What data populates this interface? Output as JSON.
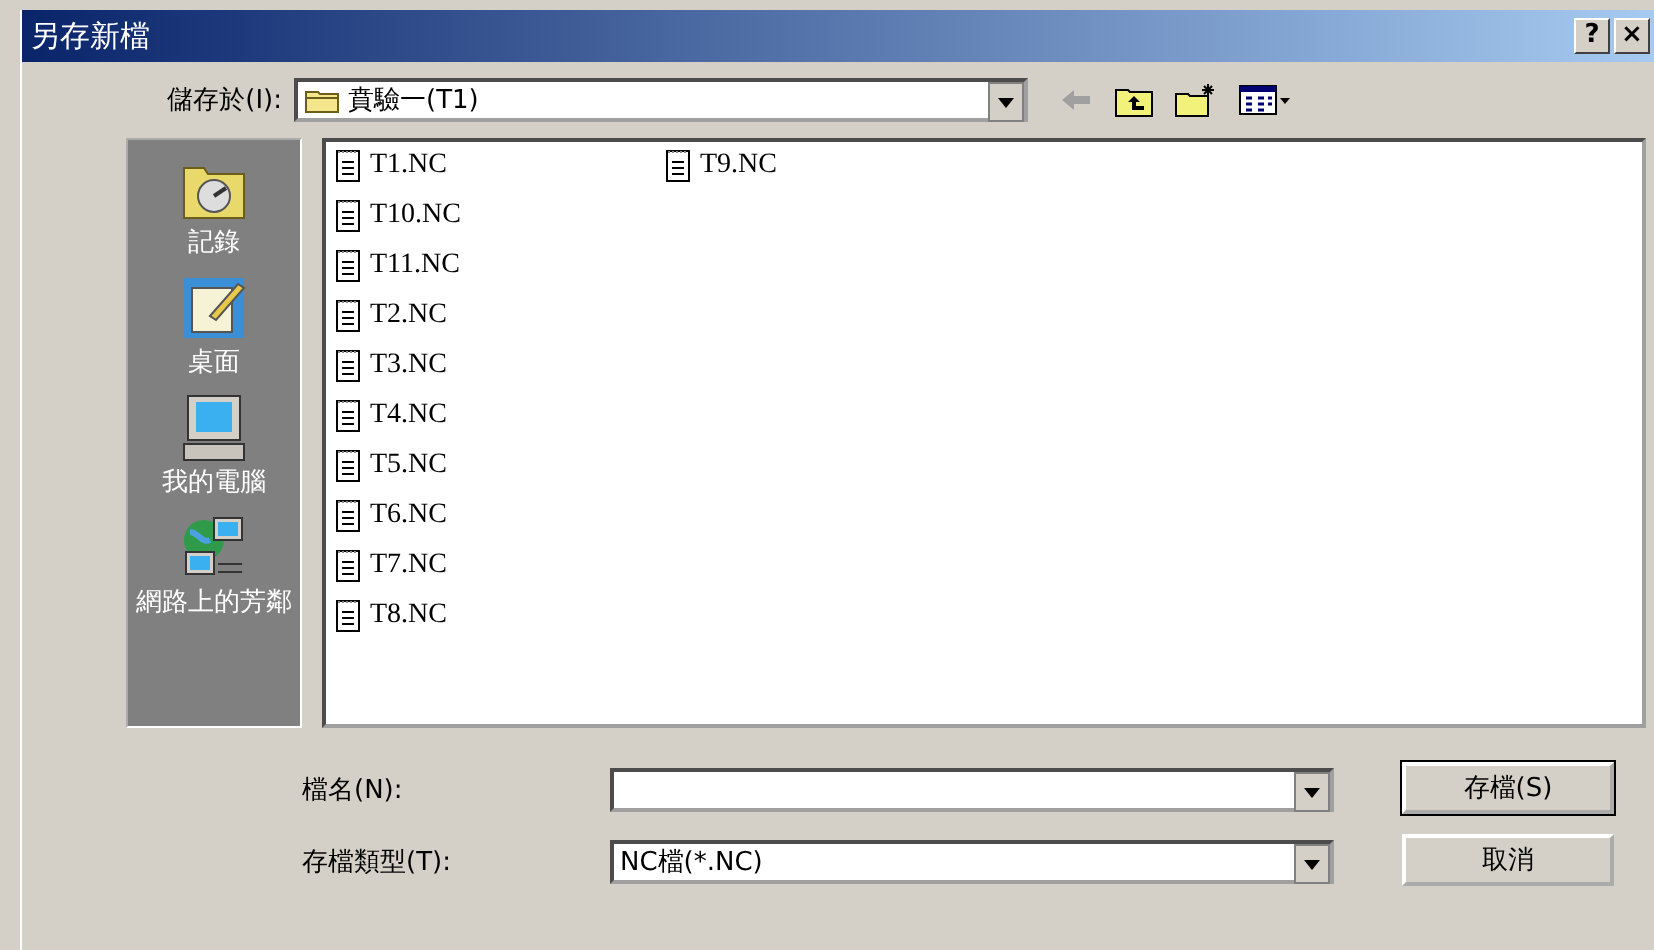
{
  "window": {
    "title": "另存新檔",
    "help_button": "?",
    "close_button": "×"
  },
  "save_in": {
    "label": "儲存於(I):",
    "value": "賁驗一(T1)"
  },
  "places": [
    {
      "label": "記錄",
      "kind": "history",
      "selected": false
    },
    {
      "label": "桌面",
      "kind": "desktop",
      "selected": false
    },
    {
      "label": "我的電腦",
      "kind": "computer",
      "selected": false
    },
    {
      "label": "網路上的芳鄰",
      "kind": "network",
      "selected": false
    }
  ],
  "files": [
    {
      "name": "T1.NC",
      "selected": false
    },
    {
      "name": "T10.NC",
      "selected": false
    },
    {
      "name": "T11.NC",
      "selected": false
    },
    {
      "name": "T2.NC",
      "selected": false
    },
    {
      "name": "T3.NC",
      "selected": false
    },
    {
      "name": "T4.NC",
      "selected": false
    },
    {
      "name": "T5.NC",
      "selected": false
    },
    {
      "name": "T6.NC",
      "selected": false
    },
    {
      "name": "T7.NC",
      "selected": false
    },
    {
      "name": "T8.NC",
      "selected": false
    },
    {
      "name": "T9.NC",
      "selected": false
    }
  ],
  "file_name": {
    "label": "檔名(N):"
  },
  "file_type": {
    "label": "存檔類型(T):",
    "value": "NC檔(*.NC)"
  },
  "buttons": [
    {
      "label": "存檔(S)",
      "default": true
    },
    {
      "label": "取消",
      "default": false
    }
  ]
}
